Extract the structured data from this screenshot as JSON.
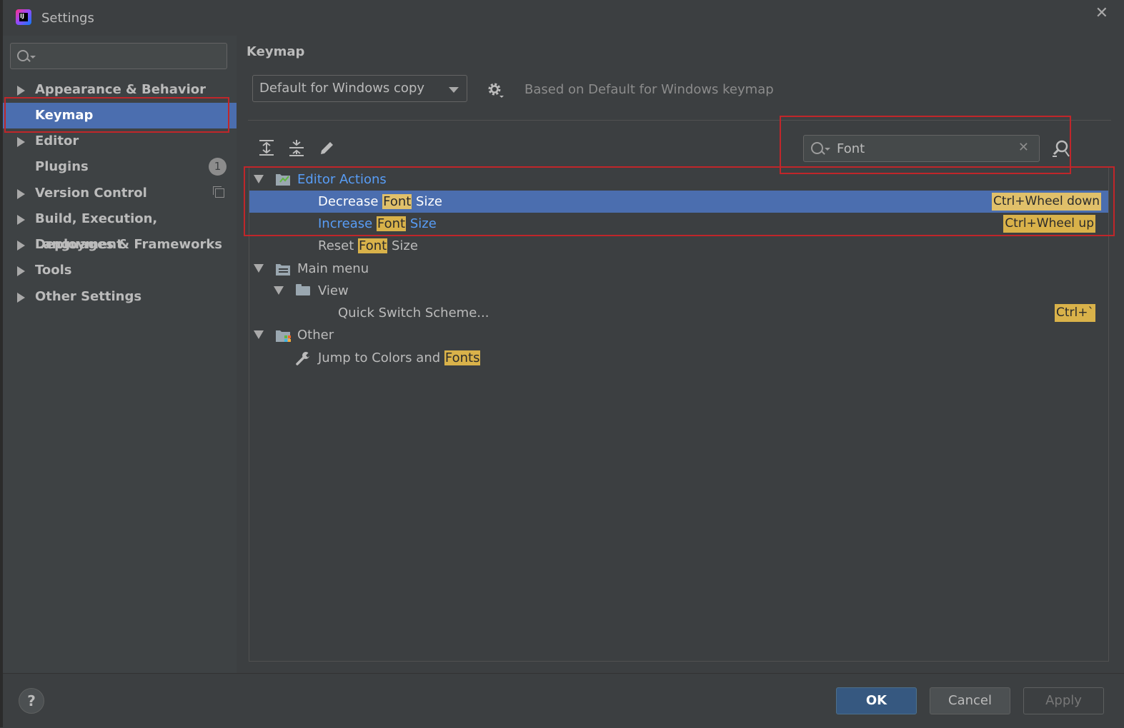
{
  "window": {
    "title": "Settings",
    "close_glyph": "✕",
    "app_icon_label": "IJ"
  },
  "sidebar": {
    "search_value": "",
    "items": [
      {
        "label": "Appearance & Behavior",
        "expandable": true
      },
      {
        "label": "Keymap",
        "expandable": false,
        "selected": true
      },
      {
        "label": "Editor",
        "expandable": true
      },
      {
        "label": "Plugins",
        "expandable": false,
        "badge": "1"
      },
      {
        "label": "Version Control",
        "expandable": true
      },
      {
        "label": "Build, Execution, Deployment",
        "expandable": true
      },
      {
        "label": "Languages & Frameworks",
        "expandable": true
      },
      {
        "label": "Tools",
        "expandable": true
      },
      {
        "label": "Other Settings",
        "expandable": true
      }
    ]
  },
  "main": {
    "title": "Keymap",
    "scheme": "Default for Windows copy",
    "based_on": "Based on Default for Windows keymap",
    "filter_value": "Font",
    "clear_glyph": "✕",
    "tree": {
      "editor_actions": "Editor Actions",
      "decrease": {
        "pre": "Decrease ",
        "hl": "Font",
        "post": " Size",
        "shortcut": "Ctrl+Wheel down"
      },
      "increase": {
        "pre": "Increase ",
        "hl": "Font",
        "post": " Size",
        "shortcut": "Ctrl+Wheel up"
      },
      "reset": {
        "pre": "Reset ",
        "hl": "Font",
        "post": " Size"
      },
      "main_menu": "Main menu",
      "view": "View",
      "quick_switch": {
        "label": "Quick Switch Scheme...",
        "shortcut": "Ctrl+`"
      },
      "other": "Other",
      "jump": {
        "pre": "Jump to Colors and ",
        "hl": "Fonts"
      }
    }
  },
  "buttons": {
    "help": "?",
    "ok": "OK",
    "cancel": "Cancel",
    "apply": "Apply"
  },
  "colors": {
    "accent": "#4b6eaf",
    "highlight": "#d9b24a",
    "link": "#589df6",
    "annotation": "#c0262a"
  }
}
